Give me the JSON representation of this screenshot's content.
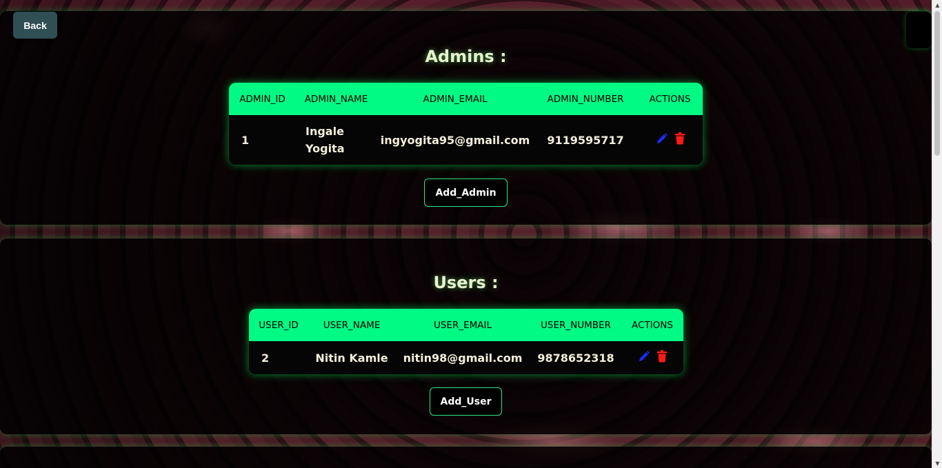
{
  "nav": {
    "back_label": "Back"
  },
  "admins": {
    "title": "Admins :",
    "columns": [
      "ADMIN_ID",
      "ADMIN_NAME",
      "ADMIN_EMAIL",
      "ADMIN_NUMBER",
      "ACTIONS"
    ],
    "rows": [
      {
        "id": "1",
        "name": "Ingale Yogita",
        "email": "ingyogita95@gmail.com",
        "number": "9119595717"
      }
    ],
    "add_label": "Add_Admin"
  },
  "users": {
    "title": "Users :",
    "columns": [
      "USER_ID",
      "USER_NAME",
      "USER_EMAIL",
      "USER_NUMBER",
      "ACTIONS"
    ],
    "rows": [
      {
        "id": "2",
        "name": "Nitin Kamle",
        "email": "nitin98@gmail.com",
        "number": "9878652318"
      }
    ],
    "add_label": "Add_User"
  },
  "icons": {
    "edit": "pencil-icon",
    "delete": "trash-icon"
  },
  "colors": {
    "header_accent": "#00fa84",
    "edit_icon": "#1a2cff",
    "delete_icon": "#ff1a1a",
    "back_button": "#2f4f55"
  }
}
